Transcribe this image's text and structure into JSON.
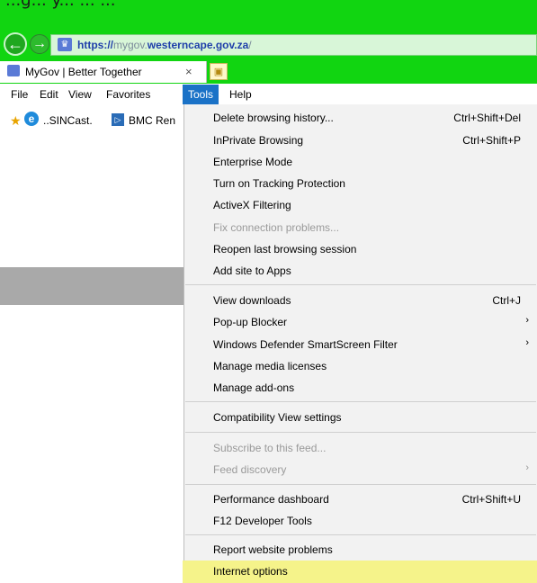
{
  "browser": {
    "partial_text": "...g... y... ... ...",
    "url": {
      "scheme": "https://",
      "subdomain": "mygov.",
      "host": "westerncape.gov.za",
      "path": "/"
    },
    "tab": {
      "title": "MyGov | Better Together",
      "close": "×"
    }
  },
  "menu_bar": [
    "File",
    "Edit",
    "View",
    "Favorites",
    "Tools",
    "Help"
  ],
  "favorites": [
    "..SINCast.",
    "BMC Ren"
  ],
  "tools_menu": {
    "items": [
      {
        "label": "Delete browsing history...",
        "shortcut": "Ctrl+Shift+Del"
      },
      {
        "label": "InPrivate Browsing",
        "shortcut": "Ctrl+Shift+P"
      },
      {
        "label": "Enterprise Mode"
      },
      {
        "label": "Turn on Tracking Protection"
      },
      {
        "label": "ActiveX Filtering"
      },
      {
        "label": "Fix connection problems...",
        "disabled": true
      },
      {
        "label": "Reopen last browsing session"
      },
      {
        "label": "Add site to Apps"
      },
      {
        "label": "View downloads",
        "shortcut": "Ctrl+J"
      },
      {
        "label": "Pop-up Blocker",
        "submenu": true
      },
      {
        "label": "Windows Defender SmartScreen Filter",
        "submenu": true
      },
      {
        "label": "Manage media licenses"
      },
      {
        "label": "Manage add-ons"
      },
      {
        "label": "Compatibility View settings"
      },
      {
        "label": "Subscribe to this feed...",
        "disabled": true
      },
      {
        "label": "Feed discovery",
        "disabled": true,
        "submenu": true
      },
      {
        "label": "Performance dashboard",
        "shortcut": "Ctrl+Shift+U"
      },
      {
        "label": "F12 Developer Tools"
      },
      {
        "label": "Report website problems"
      },
      {
        "label": "Internet options",
        "highlighted": true
      }
    ]
  },
  "colors": {
    "chrome": "#11d511",
    "highlight": "#f5f38a",
    "tools_active": "#1a72c7"
  }
}
